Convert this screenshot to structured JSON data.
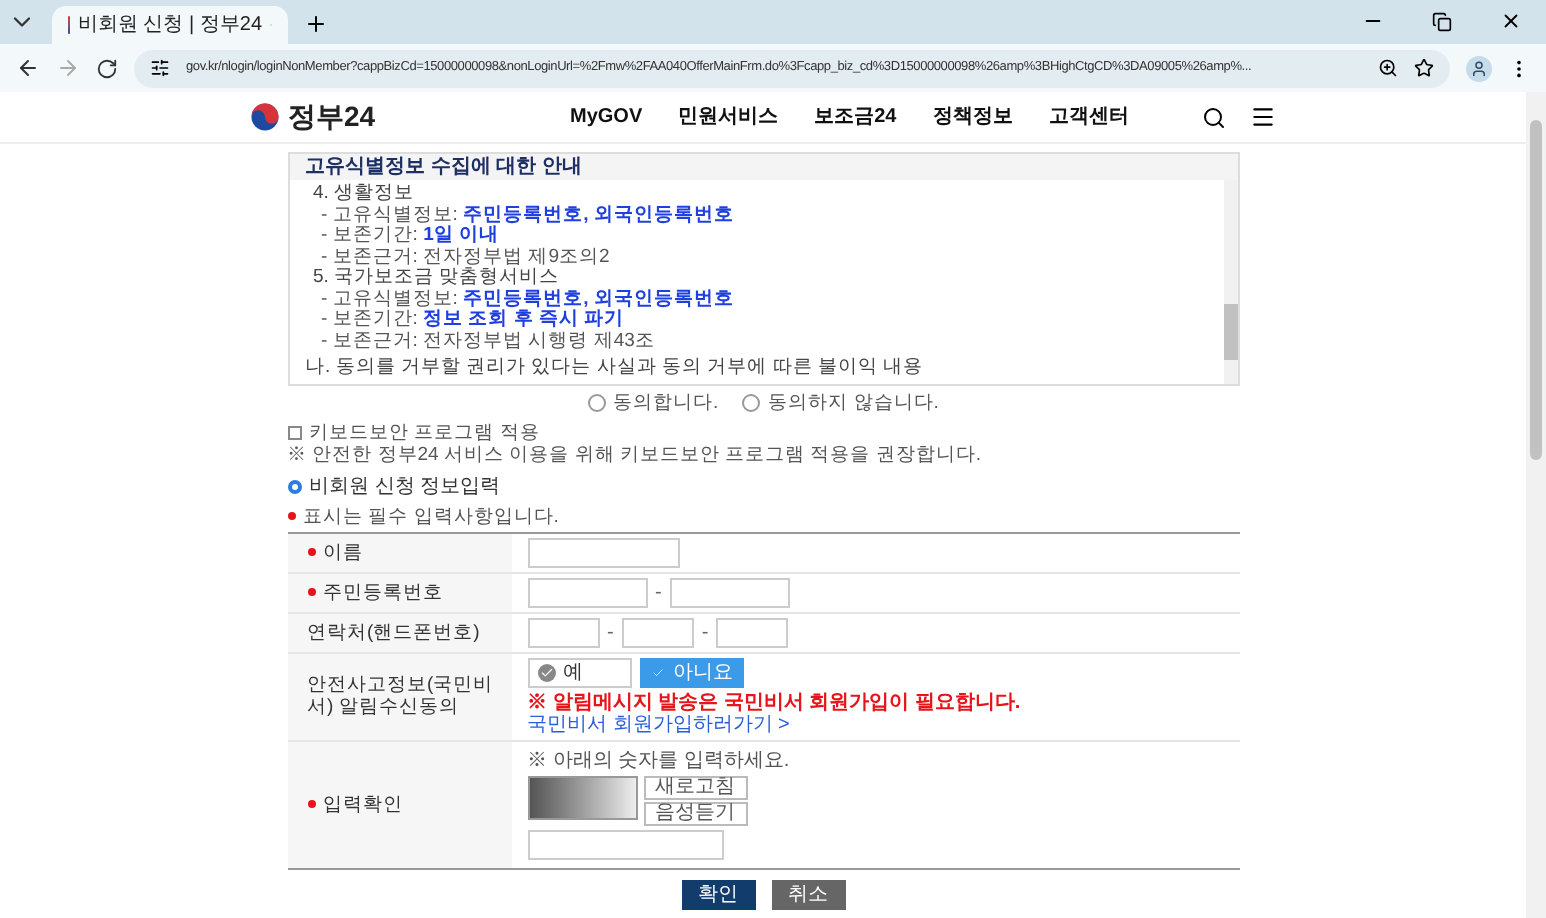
{
  "browser": {
    "tab_title": "비회원 신청 | 정부24",
    "url": "gov.kr/nlogin/loginNonMember?cappBizCd=15000000098&nonLoginUrl=%2Fmw%2FAA040OfferMainFrm.do%3Fcapp_biz_cd%3D15000000098%26amp%3BHighCtgCD%3DA09005%26amp%..."
  },
  "header": {
    "logo_text": "정부24",
    "nav": [
      "MyGOV",
      "민원서비스",
      "보조금24",
      "정책정보",
      "고객센터"
    ]
  },
  "privacy": {
    "title": "고유식별정보 수집에 대한 안내",
    "lines": [
      {
        "kind": "heading",
        "label": "4. 생활정보"
      },
      {
        "kind": "item",
        "label": "- 고유식별정보: ",
        "value": "주민등록번호, 외국인등록번호",
        "highlight": true
      },
      {
        "kind": "item",
        "label": "- 보존기간: ",
        "value": "1일 이내",
        "highlight": true
      },
      {
        "kind": "item",
        "label": "- 보존근거: ",
        "value": "전자정부법 제9조의2",
        "highlight": false
      },
      {
        "kind": "heading",
        "label": "5. 국가보조금 맞춤형서비스"
      },
      {
        "kind": "item",
        "label": "- 고유식별정보: ",
        "value": "주민등록번호, 외국인등록번호",
        "highlight": true
      },
      {
        "kind": "item",
        "label": "- 보존기간: ",
        "value": "정보 조회 후 즉시 파기",
        "highlight": true
      },
      {
        "kind": "item",
        "label": "- 보존근거: ",
        "value": "전자정부법 시행령 제43조",
        "highlight": false
      },
      {
        "kind": "section",
        "label": "나. 동의를 거부할 권리가 있다는 사실과 동의 거부에 따른 불이익 내용"
      }
    ]
  },
  "consent": [
    {
      "label": "동의합니다.",
      "selected": false
    },
    {
      "label": "동의하지 않습니다.",
      "selected": false
    }
  ],
  "keyboard_security": {
    "label": "키보드보안 프로그램 적용",
    "checked": false,
    "note": "※ 안전한 정부24 서비스 이용을 위해 키보드보안 프로그램 적용을 권장합니다."
  },
  "section_title": "비회원 신청 정보입력",
  "required_note": "표시는 필수 입력사항입니다.",
  "form": [
    {
      "kind": "text",
      "label": "이름",
      "required": true
    },
    {
      "kind": "rrn",
      "label": "주민등록번호",
      "required": true,
      "separator": "-"
    },
    {
      "kind": "phone",
      "label": "연락처(핸드폰번호)",
      "required": false,
      "separator": "-"
    },
    {
      "kind": "toggle",
      "label": "안전사고정보(국민비서) 알림수신동의",
      "required": false,
      "options": [
        {
          "label": "예",
          "selected": false
        },
        {
          "label": "아니요",
          "selected": true
        }
      ],
      "warning": "※ 알림메시지 발송은 국민비서 회원가입이 필요합니다.",
      "link": "국민비서 회원가입하러가기 >"
    },
    {
      "kind": "captcha",
      "label": "입력확인",
      "required": true,
      "instruction": "※ 아래의 숫자를 입력하세요.",
      "buttons": [
        "새로고침",
        "음성듣기"
      ]
    }
  ],
  "actions": [
    {
      "label": "확인",
      "kind": "primary"
    },
    {
      "label": "취소",
      "kind": "secondary"
    }
  ]
}
